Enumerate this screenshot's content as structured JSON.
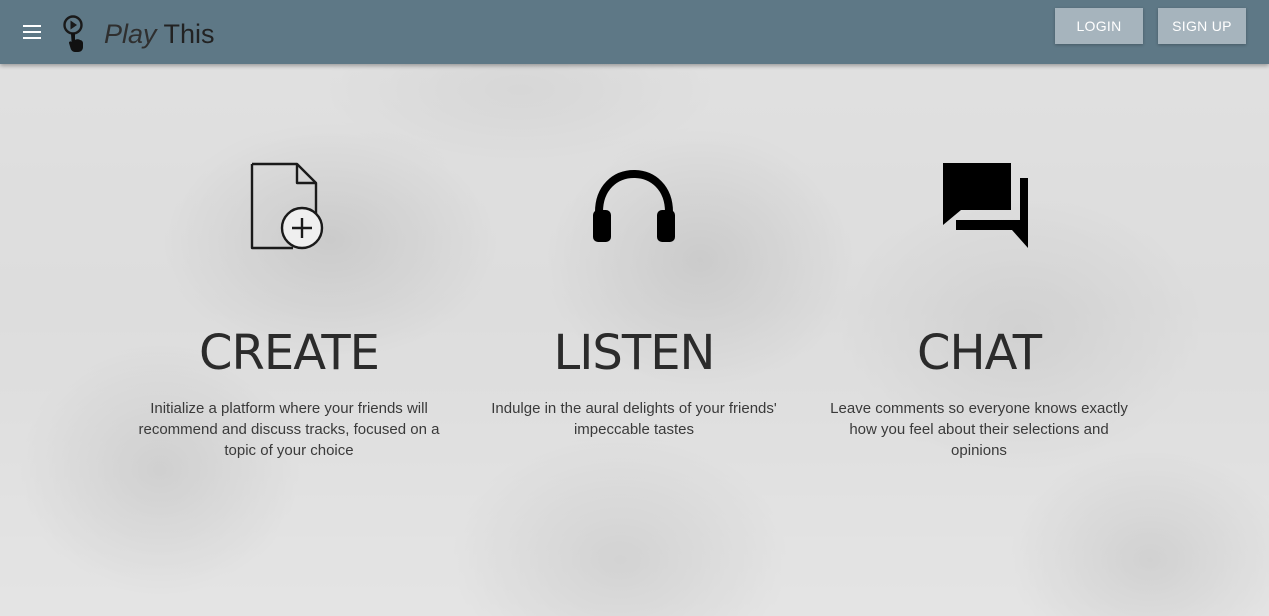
{
  "header": {
    "brand_part1": "Play",
    "brand_part2": "This",
    "login_label": "LOGIN",
    "signup_label": "SIGN UP",
    "background_color": "#5e7886",
    "button_color": "#a6b4bd",
    "menu_icon": "menu-icon",
    "logo_icon": "play-touch-logo-icon"
  },
  "features": [
    {
      "icon": "file-add-icon",
      "title": "CREATE",
      "description": "Initialize a platform where your friends will recommend and discuss tracks, focused on a topic of your choice"
    },
    {
      "icon": "headphones-icon",
      "title": "LISTEN",
      "description": "Indulge in the aural delights of your friends' impeccable tastes"
    },
    {
      "icon": "chat-bubbles-icon",
      "title": "CHAT",
      "description": "Leave comments so everyone knows exactly how you feel about their selections and opinions"
    }
  ]
}
